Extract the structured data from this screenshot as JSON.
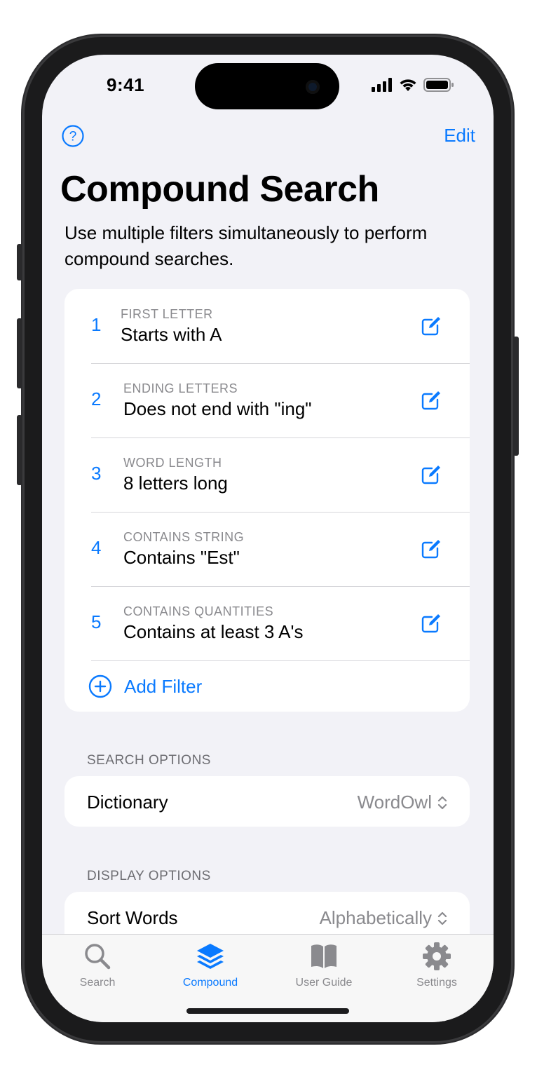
{
  "status": {
    "time": "9:41"
  },
  "nav": {
    "edit_label": "Edit"
  },
  "title": "Compound Search",
  "description": "Use multiple filters simultaneously to perform compound searches.",
  "filters": [
    {
      "number": "1",
      "caption": "FIRST LETTER",
      "value": "Starts with A"
    },
    {
      "number": "2",
      "caption": "ENDING LETTERS",
      "value": "Does not end with \"ing\""
    },
    {
      "number": "3",
      "caption": "WORD LENGTH",
      "value": "8 letters long"
    },
    {
      "number": "4",
      "caption": "CONTAINS STRING",
      "value": "Contains \"Est\""
    },
    {
      "number": "5",
      "caption": "CONTAINS QUANTITIES",
      "value": "Contains at least 3 A's"
    }
  ],
  "add_filter_label": "Add Filter",
  "search_options": {
    "header": "SEARCH OPTIONS",
    "dictionary_label": "Dictionary",
    "dictionary_value": "WordOwl"
  },
  "display_options": {
    "header": "DISPLAY OPTIONS",
    "sort_label": "Sort Words",
    "sort_value": "Alphabetically"
  },
  "tabs": [
    {
      "label": "Search",
      "icon": "magnifier-icon",
      "active": false
    },
    {
      "label": "Compound",
      "icon": "layers-icon",
      "active": true
    },
    {
      "label": "User Guide",
      "icon": "book-icon",
      "active": false
    },
    {
      "label": "Settings",
      "icon": "gear-icon",
      "active": false
    }
  ],
  "colors": {
    "accent": "#0a7aff",
    "secondary_text": "#8a8a8e",
    "background": "#f2f2f7"
  }
}
